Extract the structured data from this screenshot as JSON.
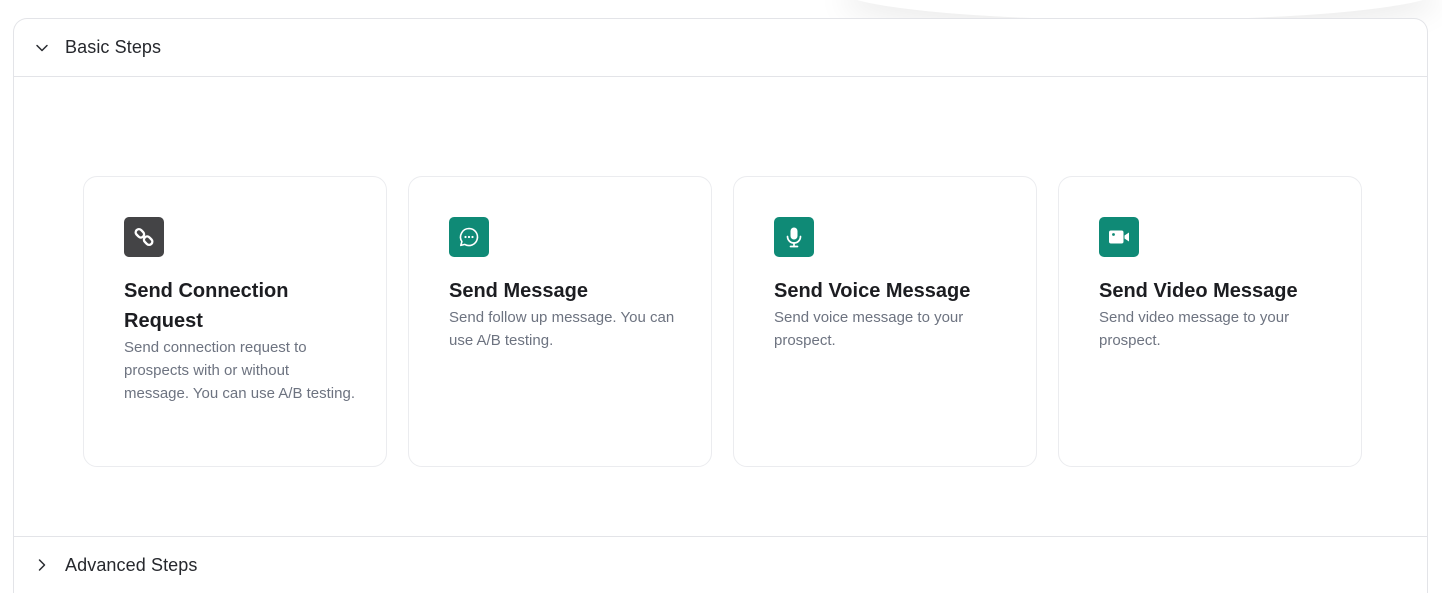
{
  "sections": {
    "basic": {
      "title": "Basic Steps",
      "expanded": true
    },
    "advanced": {
      "title": "Advanced Steps",
      "expanded": false
    }
  },
  "cards": [
    {
      "title": "Send Connection Request",
      "description": "Send connection request to prospects with or without message. You can use A/B testing.",
      "icon": "link-icon",
      "icon_color": "#444446"
    },
    {
      "title": "Send Message",
      "description": "Send follow up message. You can use A/B testing.",
      "icon": "chat-bubble-icon",
      "icon_color": "#0f8a76"
    },
    {
      "title": "Send Voice Message",
      "description": "Send voice message to your prospect.",
      "icon": "microphone-icon",
      "icon_color": "#0f8a76"
    },
    {
      "title": "Send Video Message",
      "description": "Send video message to your prospect.",
      "icon": "video-camera-icon",
      "icon_color": "#0f8a76"
    }
  ]
}
